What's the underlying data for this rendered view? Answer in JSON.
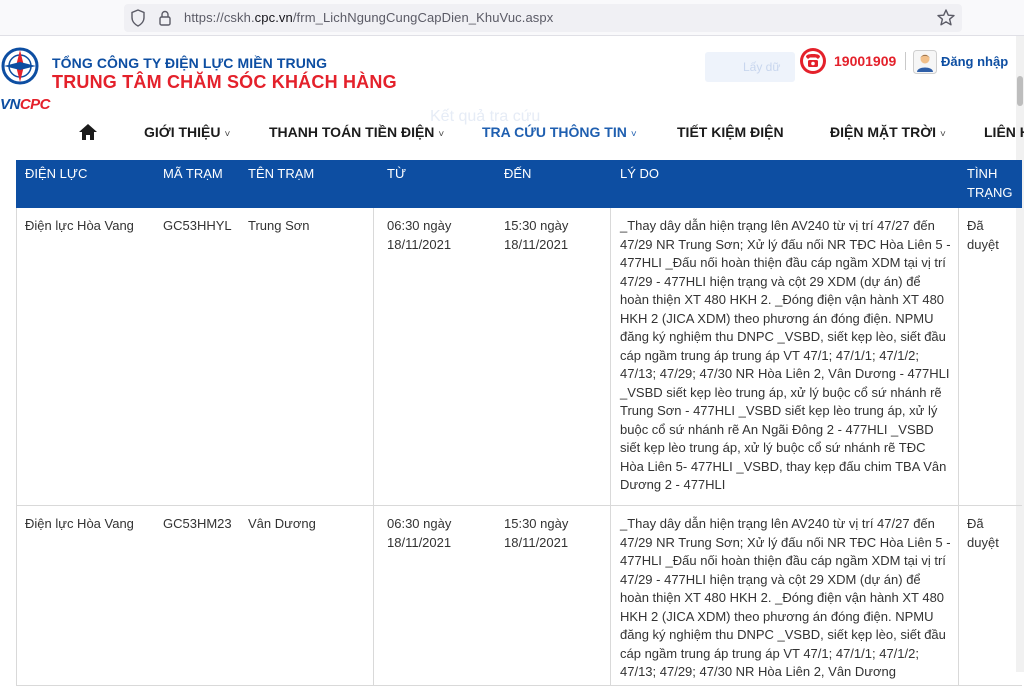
{
  "browser": {
    "url_prefix": "https://cskh.",
    "url_host": "cpc.vn",
    "url_path": "/frm_LichNgungCungCapDien_KhuVuc.aspx"
  },
  "header": {
    "company": "TỔNG CÔNG TY ĐIỆN LỰC MIỀN TRUNG",
    "center": "TRUNG TÂM CHĂM SÓC KHÁCH HÀNG",
    "brand_vn": "VN",
    "brand_cpc": "CPC",
    "hotline": "19001909",
    "login": "Đăng nhập",
    "ghost_button": "Lấy dữ",
    "faded_title": "Kết quả tra cứu"
  },
  "nav": {
    "items": [
      {
        "label": "GIỚI THIỆU",
        "chevron": "˅"
      },
      {
        "label": "THANH TOÁN TIỀN ĐIỆN",
        "chevron": "˅"
      },
      {
        "label": "TRA CỨU THÔNG TIN",
        "chevron": "˅"
      },
      {
        "label": "TIẾT KIỆM ĐIỆN",
        "chevron": ""
      },
      {
        "label": "ĐIỆN MẶT TRỜI",
        "chevron": "˅"
      },
      {
        "label": "LIÊN H",
        "chevron": ""
      }
    ]
  },
  "table": {
    "headers": [
      "ĐIỆN LỰC",
      "MÃ TRẠM",
      "TÊN TRẠM",
      "TỪ",
      "ĐẾN",
      "LÝ DO",
      "TÌNH TRẠNG"
    ],
    "rows": [
      {
        "dien_luc": "Điện lực Hòa Vang",
        "ma_tram": "GC53HHYL",
        "ten_tram": "Trung Sơn",
        "tu": "06:30 ngày 18/11/2021",
        "den": "15:30 ngày 18/11/2021",
        "ly_do": "_Thay dây dẫn hiện trạng lên AV240 từ vị trí 47/27 đến 47/29 NR Trung Sơn; Xử lý đấu nối NR TĐC Hòa Liên 5 - 477HLI _Đấu nối hoàn thiện đầu cáp ngầm XDM tại vị trí 47/29 - 477HLI hiện trạng và cột 29 XDM (dự án) để hoàn thiện XT 480 HKH 2. _Đóng điện vận hành XT 480 HKH 2 (JICA XDM) theo phương án đóng điện. NPMU đăng ký nghiệm thu DNPC _VSBD, siết kẹp lèo, siết đầu cáp ngầm trung áp trung áp VT 47/1; 47/1/1; 47/1/2; 47/13; 47/29; 47/30 NR Hòa Liên 2, Vân Dương - 477HLI _VSBD siết kẹp lèo trung áp, xử lý buộc cổ sứ nhánh rẽ Trung Sơn - 477HLI _VSBD siết kẹp lèo trung áp, xử lý buộc cổ sứ nhánh rẽ An Ngãi Đông 2 - 477HLI _VSBD siết kẹp lèo trung áp, xử lý buộc cổ sứ nhánh rẽ TĐC Hòa Liên 5- 477HLI _VSBD, thay kẹp đấu chim TBA Vân Dương 2 - 477HLI",
        "tinh_trang": "Đã duyệt"
      },
      {
        "dien_luc": "Điện lực Hòa Vang",
        "ma_tram": "GC53HM23",
        "ten_tram": "Vân Dương",
        "tu": "06:30 ngày 18/11/2021",
        "den": "15:30 ngày 18/11/2021",
        "ly_do": "_Thay dây dẫn hiện trạng lên AV240 từ vị trí 47/27 đến 47/29 NR Trung Sơn; Xử lý đấu nối NR TĐC Hòa Liên 5 - 477HLI _Đấu nối hoàn thiện đầu cáp ngầm XDM tại vị trí 47/29 - 477HLI hiện trạng và cột 29 XDM (dự án) để hoàn thiện XT 480 HKH 2. _Đóng điện vận hành XT 480 HKH 2 (JICA XDM) theo phương án đóng điện. NPMU đăng ký nghiệm thu DNPC _VSBD, siết kẹp lèo, siết đầu cáp ngầm trung áp trung áp VT 47/1; 47/1/1; 47/1/2; 47/13; 47/29; 47/30 NR Hòa Liên 2, Vân Dương",
        "tinh_trang": "Đã duyệt"
      }
    ]
  },
  "icons": {
    "shield": "shield-icon",
    "lock": "lock-icon",
    "star": "star-icon",
    "phone": "phone-icon",
    "user": "user-icon",
    "home": "home-icon"
  },
  "colors": {
    "brand_blue": "#0d4ea2",
    "brand_red": "#e4212b",
    "nav_active": "#1f5fb0"
  }
}
